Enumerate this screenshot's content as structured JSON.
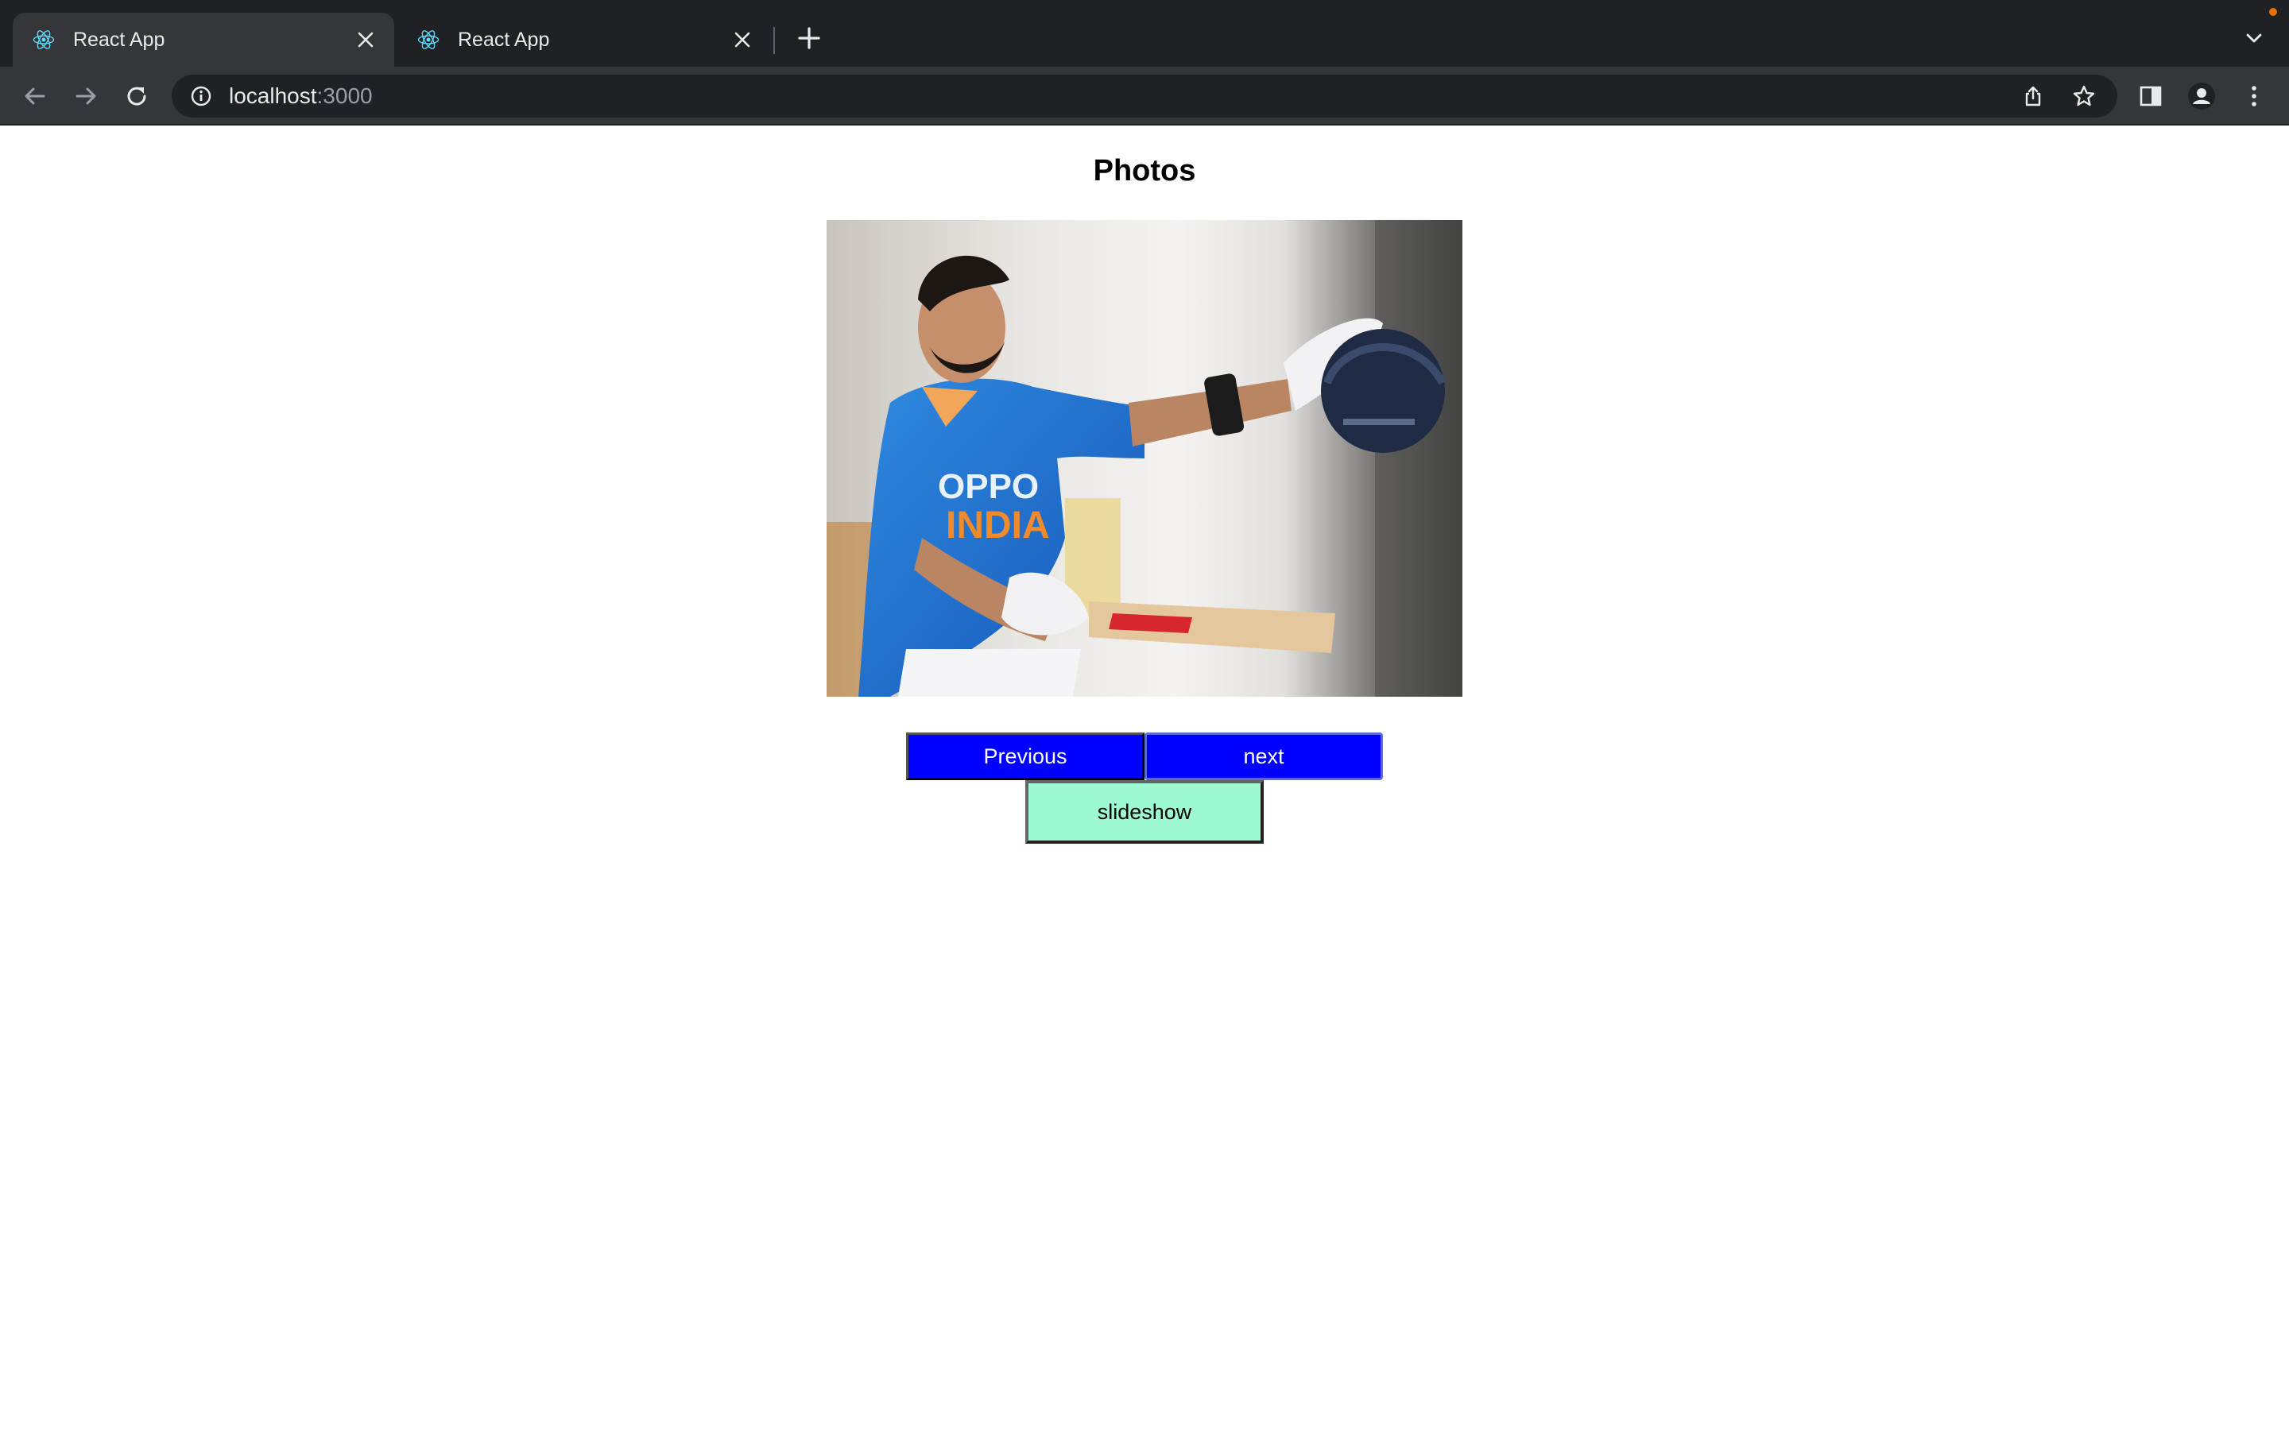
{
  "browser": {
    "tabs": [
      {
        "title": "React App",
        "active": true,
        "favicon": "react-icon"
      },
      {
        "title": "React App",
        "active": false,
        "favicon": "react-icon"
      }
    ],
    "address": {
      "host": "localhost",
      "port": ":3000"
    },
    "icons": {
      "back": "arrow-left-icon",
      "forward": "arrow-right-icon",
      "reload": "reload-icon",
      "info": "info-icon",
      "share": "share-icon",
      "bookmark": "star-icon",
      "sidepanel": "side-panel-icon",
      "profile": "profile-icon",
      "menu": "kebab-menu-icon",
      "newtab": "plus-icon",
      "tabsearch": "chevron-down-icon"
    },
    "colors": {
      "tabstrip": "#202124",
      "toolbar": "#35363a",
      "react": "#61dafb"
    }
  },
  "page": {
    "title": "Photos",
    "photo": {
      "description_icon": "cricketer-photo"
    },
    "buttons": {
      "previous": "Previous",
      "next": "next",
      "slideshow": "slideshow"
    },
    "colors": {
      "nav_button_bg": "#0000ff",
      "slideshow_bg": "#9dfad3"
    }
  }
}
